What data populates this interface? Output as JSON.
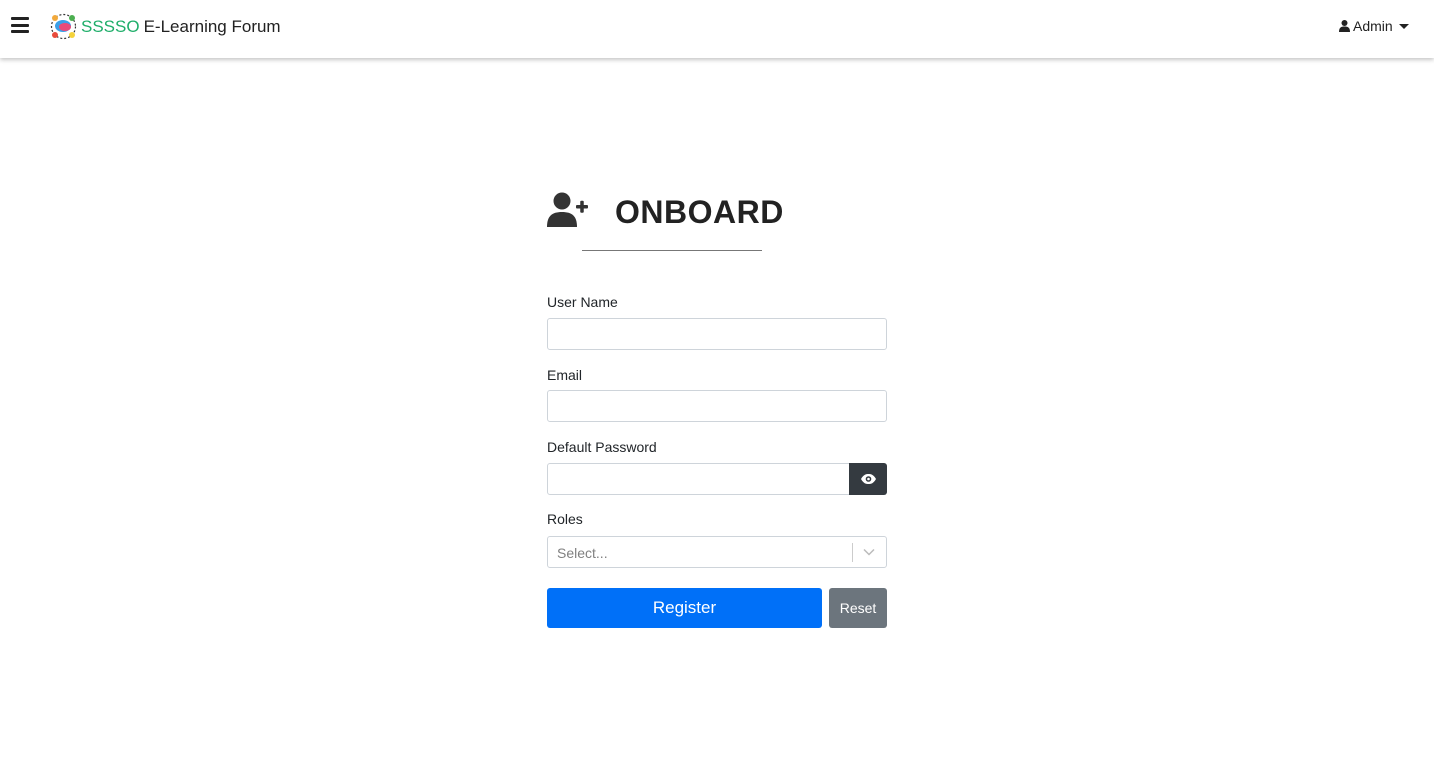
{
  "navbar": {
    "brand_accent": "SSSSO",
    "brand_rest": "E-Learning Forum",
    "user_label": "Admin",
    "accent_color": "#1fae6a"
  },
  "form": {
    "title": "ONBOARD",
    "username_label": "User Name",
    "username_value": "",
    "email_label": "Email",
    "email_value": "",
    "password_label": "Default Password",
    "password_value": "",
    "roles_label": "Roles",
    "roles_placeholder": "Select...",
    "register_label": "Register",
    "reset_label": "Reset"
  },
  "icons": {
    "menu": "hamburger-menu-icon",
    "logo": "forum-logo-icon",
    "user": "user-icon",
    "onboard": "user-plus-icon",
    "password_toggle": "eye-icon",
    "select": "chevron-down-icon"
  },
  "colors": {
    "primary": "#0070f8",
    "secondary": "#6c757d",
    "dark": "#343a40"
  }
}
